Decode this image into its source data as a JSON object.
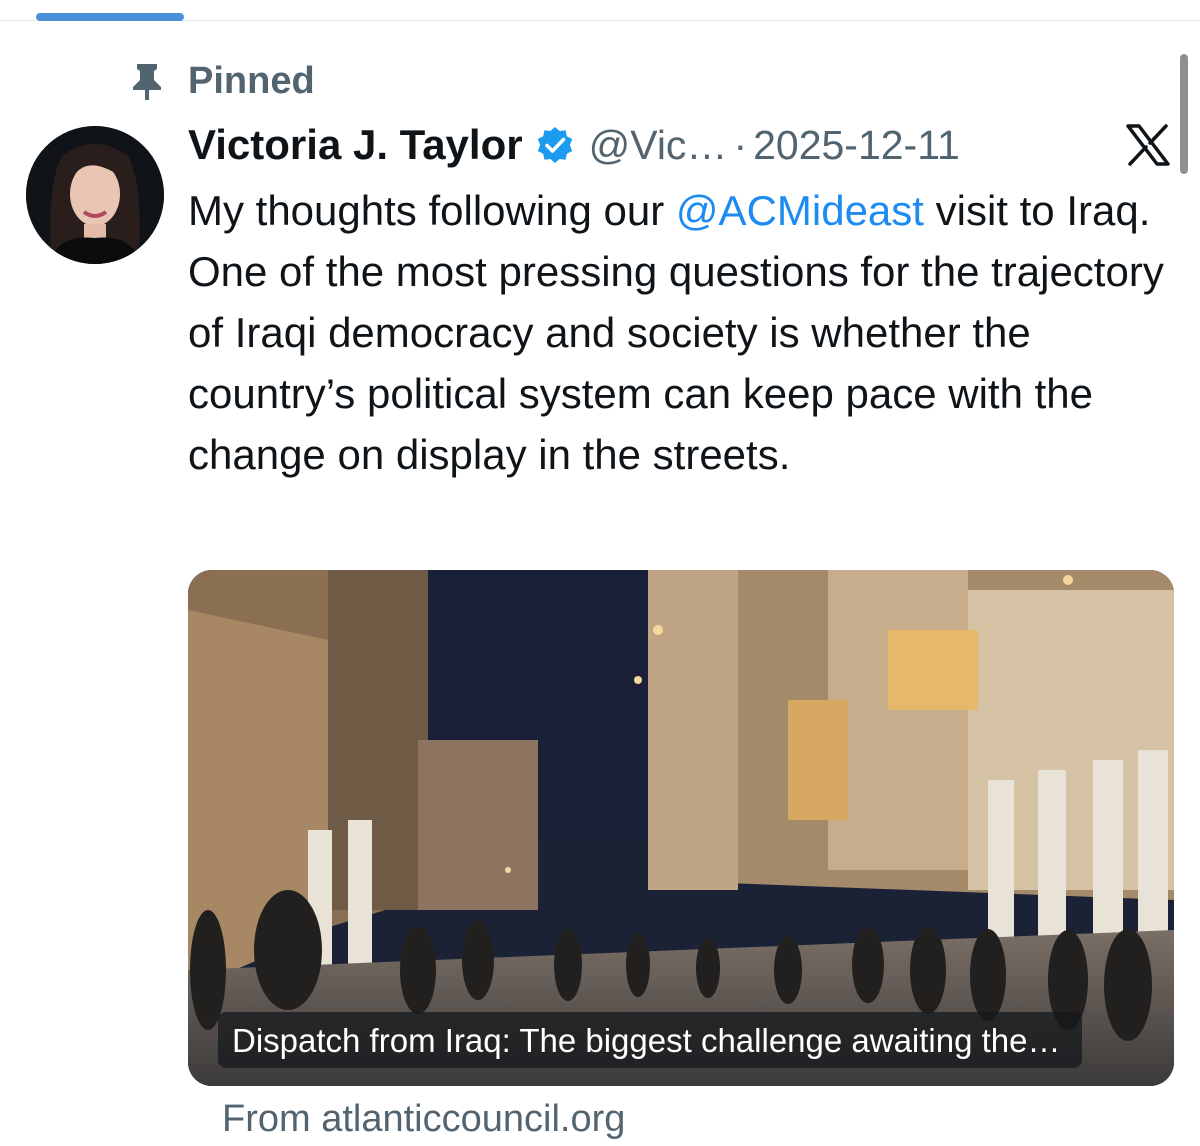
{
  "pinned": {
    "label": "Pinned",
    "icon": "pin-icon"
  },
  "tweet": {
    "author_name": "Victoria J. Taylor",
    "verified_icon": "verified-badge-icon",
    "handle": "@Vic…",
    "separator": "·",
    "date": "2025-12-11",
    "text_before": "My thoughts following our ",
    "mention": "@ACMideast",
    "text_after": " visit to Iraq. One of the most pressing questions for the trajectory of Iraqi democracy and society is whether the country’s political system can keep pace with the change on display in the streets."
  },
  "card": {
    "caption": "Dispatch from Iraq: The biggest challenge awaiting the…",
    "source": "From atlanticcouncil.org"
  },
  "colors": {
    "text": "#0f1419",
    "secondary": "#536471",
    "link": "#1d8bf0",
    "verified": "#1d9bf0"
  }
}
